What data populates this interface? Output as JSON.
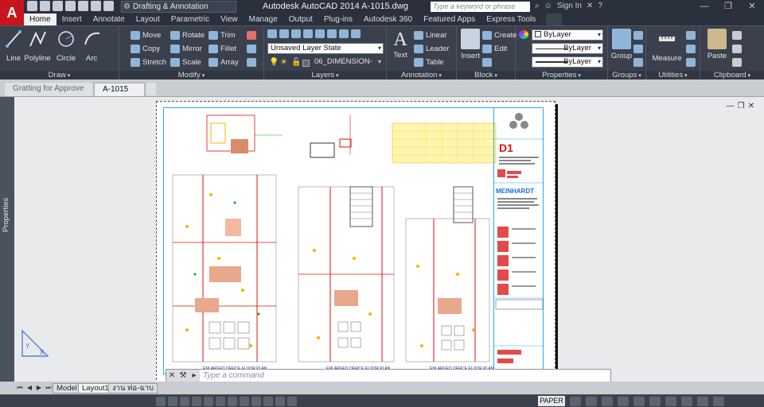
{
  "app": {
    "logo_letter": "A",
    "workspace": "Drafting & Annotation",
    "title": "Autodesk AutoCAD 2014    A-1015.dwg",
    "search_placeholder": "Type a keyword or phrase",
    "sign_in": "Sign In"
  },
  "ribbon_tabs": [
    "Home",
    "Insert",
    "Annotate",
    "Layout",
    "Parametric",
    "View",
    "Manage",
    "Output",
    "Plug-ins",
    "Autodesk 360",
    "Featured Apps",
    "Express Tools"
  ],
  "ribbon": {
    "draw": {
      "title": "Draw",
      "line": "Line",
      "polyline": "Polyline",
      "circle": "Circle",
      "arc": "Arc"
    },
    "modify": {
      "title": "Modify",
      "move": "Move",
      "rotate": "Rotate",
      "trim": "Trim",
      "copy": "Copy",
      "mirror": "Mirror",
      "fillet": "Fillet",
      "stretch": "Stretch",
      "scale": "Scale",
      "array": "Array"
    },
    "layers": {
      "title": "Layers",
      "layer_state": "Unsaved Layer State",
      "current_layer": "06_DIMENSION-"
    },
    "annotation": {
      "title": "Annotation",
      "text": "Text",
      "linear": "Linear",
      "leader": "Leader",
      "table": "Table"
    },
    "block": {
      "title": "Block",
      "insert": "Insert",
      "create": "Create",
      "edit": "Edit"
    },
    "properties": {
      "title": "Properties",
      "color": "ByLayer",
      "linetype": "ByLayer",
      "lineweight": "ByLayer"
    },
    "groups": {
      "title": "Groups",
      "group": "Group"
    },
    "utilities": {
      "title": "Utilities",
      "measure": "Measure"
    },
    "clipboard": {
      "title": "Clipboard",
      "paste": "Paste"
    }
  },
  "doc_tabs": [
    "Gratting for Approve",
    "A-1015"
  ],
  "side_panel": "Properties",
  "command": {
    "placeholder": "Type a command"
  },
  "layout_tabs": [
    "Model",
    "Layout1",
    "งาน ท่อ-ฉาบ"
  ],
  "status": {
    "coords": "",
    "paper": "PAPER"
  },
  "drawing": {
    "plan_labels": [
      "ENLARGED OFFICE FLOOR PLAN",
      "ENLARGED OFFICE FLOOR PLAN",
      "ENLARGED OFFICE FLOOR PLAN"
    ],
    "firm_a": "D1",
    "firm_b": "MEINHARDT"
  }
}
